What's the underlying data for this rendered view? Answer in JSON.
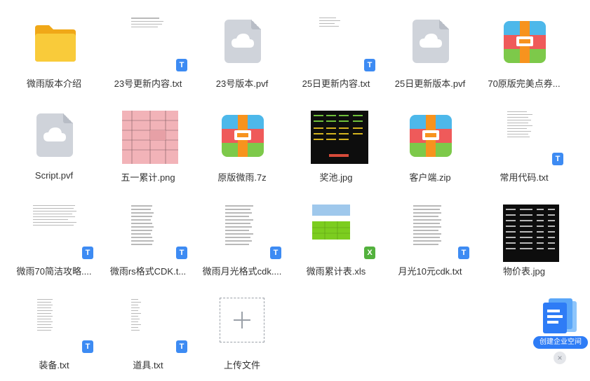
{
  "files": [
    {
      "name": "微雨版本介绍",
      "kind": "folder"
    },
    {
      "name": "23号更新内容.txt",
      "kind": "txt"
    },
    {
      "name": "23号版本.pvf",
      "kind": "pvf"
    },
    {
      "name": "25日更新内容.txt",
      "kind": "txt"
    },
    {
      "name": "25日更新版本.pvf",
      "kind": "pvf"
    },
    {
      "name": "70原版完美点券...",
      "kind": "archive"
    },
    {
      "name": "Script.pvf",
      "kind": "pvf"
    },
    {
      "name": "五一累计.png",
      "kind": "image-table"
    },
    {
      "name": "原版微雨.7z",
      "kind": "archive"
    },
    {
      "name": "奖池.jpg",
      "kind": "image-dark"
    },
    {
      "name": "客户端.zip",
      "kind": "archive"
    },
    {
      "name": "常用代码.txt",
      "kind": "txt"
    },
    {
      "name": "微雨70简洁攻略....",
      "kind": "txt"
    },
    {
      "name": "微雨rs格式CDK.t...",
      "kind": "txt"
    },
    {
      "name": "微雨月光格式cdk....",
      "kind": "txt"
    },
    {
      "name": "微雨累计表.xls",
      "kind": "xls"
    },
    {
      "name": "月光10元cdk.txt",
      "kind": "txt"
    },
    {
      "name": "物价表.jpg",
      "kind": "image-dark"
    },
    {
      "name": "装备.txt",
      "kind": "txt"
    },
    {
      "name": "道具.txt",
      "kind": "txt"
    },
    {
      "name": "上传文件",
      "kind": "upload"
    }
  ],
  "badges": {
    "txt": "T",
    "xls": "X"
  },
  "promo": {
    "label": "创建企业空间"
  },
  "close": {
    "symbol": "×"
  },
  "colors": {
    "accent": "#3d8bf3",
    "folder": "#f7c531",
    "excel": "#53b13d"
  }
}
